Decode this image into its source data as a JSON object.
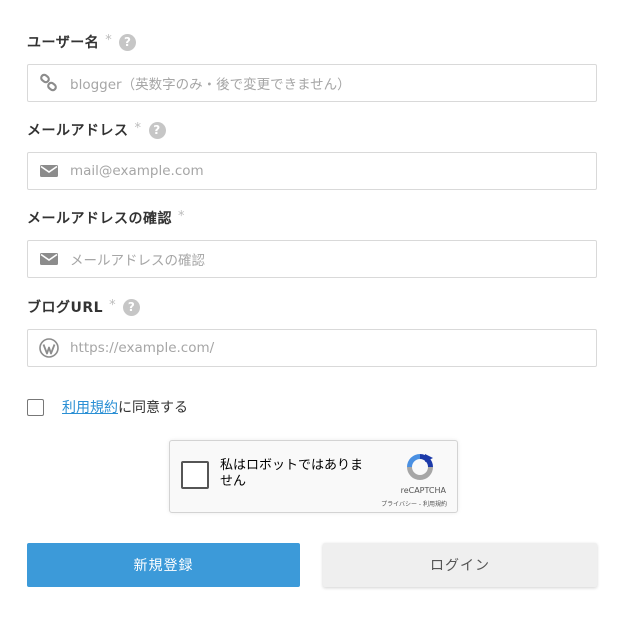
{
  "form": {
    "username": {
      "label": "ユーザー名",
      "required_mark": "*",
      "help_glyph": "?",
      "placeholder": "blogger（英数字のみ・後で変更できません）",
      "icon": "link-icon"
    },
    "email": {
      "label": "メールアドレス",
      "required_mark": "*",
      "help_glyph": "?",
      "placeholder": "mail@example.com",
      "icon": "mail-icon"
    },
    "email_confirm": {
      "label": "メールアドレスの確認",
      "required_mark": "*",
      "placeholder": "メールアドレスの確認",
      "icon": "mail-icon"
    },
    "blog_url": {
      "label": "ブログURL",
      "required_mark": "*",
      "help_glyph": "?",
      "placeholder": "https://example.com/",
      "icon": "wordpress-icon"
    },
    "terms": {
      "link_text": "利用規約",
      "suffix_text": "に同意する"
    }
  },
  "recaptcha": {
    "checkbox_label": "私はロボットではありません",
    "brand": "reCAPTCHA",
    "links": "プライバシー - 利用規約"
  },
  "buttons": {
    "register": "新規登録",
    "login": "ログイン"
  },
  "colors": {
    "primary": "#3c9ad9",
    "link": "#2a8fd4",
    "help_badge": "#c6c6c6"
  }
}
